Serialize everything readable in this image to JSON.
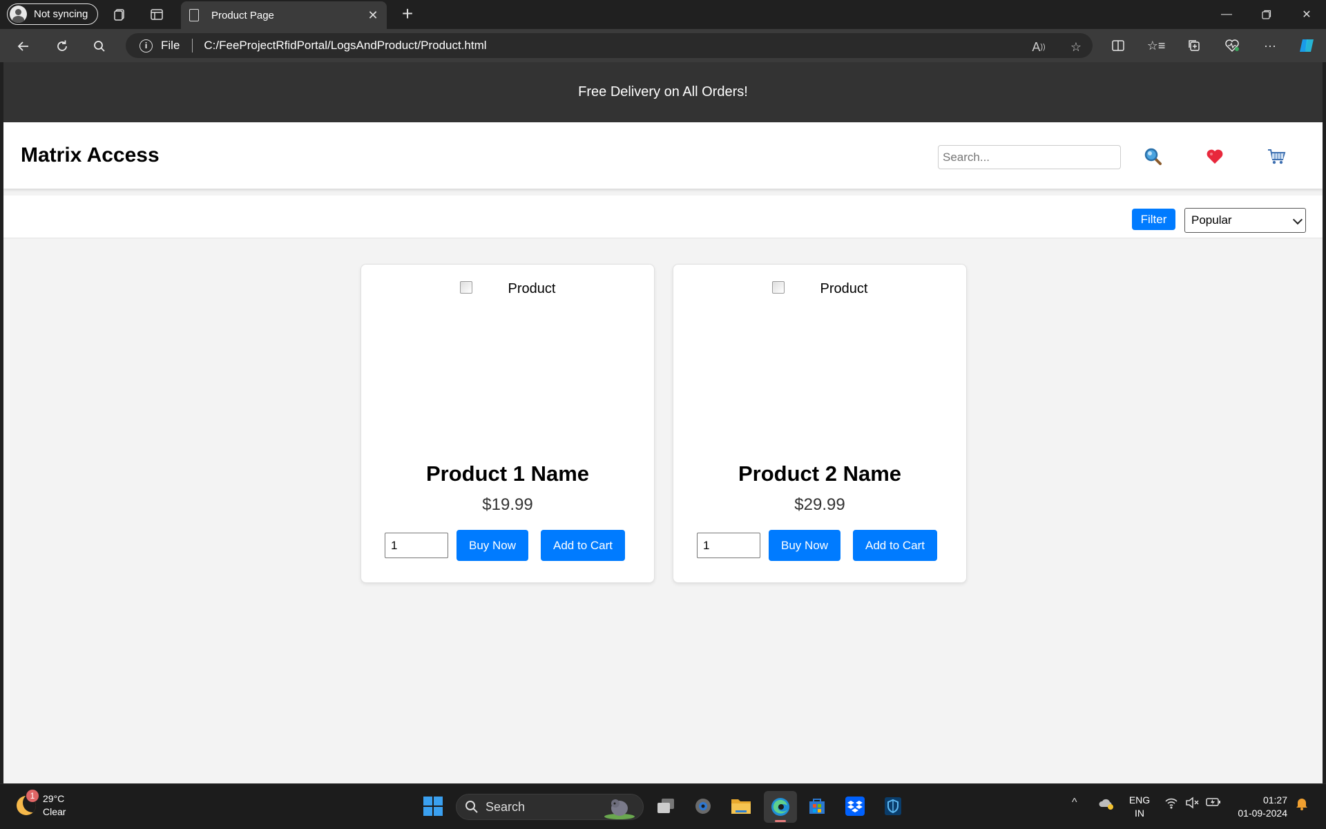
{
  "browser": {
    "profile_label": "Not syncing",
    "tab_title": "Product Page",
    "address_scheme": "File",
    "address_url": "C:/FeeProjectRfidPortal/LogsAndProduct/Product.html"
  },
  "page": {
    "promo_text": "Free Delivery on All Orders!",
    "brand": "Matrix Access",
    "search_placeholder": "Search...",
    "filter_label": "Filter",
    "sort_selected": "Popular",
    "products": [
      {
        "image_alt": "Product",
        "name": "Product 1 Name",
        "price": "$19.99",
        "qty": "1",
        "buy_label": "Buy Now",
        "cart_label": "Add to Cart"
      },
      {
        "image_alt": "Product",
        "name": "Product 2 Name",
        "price": "$29.99",
        "qty": "1",
        "buy_label": "Buy Now",
        "cart_label": "Add to Cart"
      }
    ]
  },
  "taskbar": {
    "weather_temp": "29°C",
    "weather_desc": "Clear",
    "weather_badge": "1",
    "search_label": "Search",
    "lang_line1": "ENG",
    "lang_line2": "IN",
    "time": "01:27",
    "date": "01-09-2024"
  },
  "colors": {
    "accent": "#007bff",
    "promo_bg": "#333333",
    "page_bg": "#f3f3f3"
  }
}
